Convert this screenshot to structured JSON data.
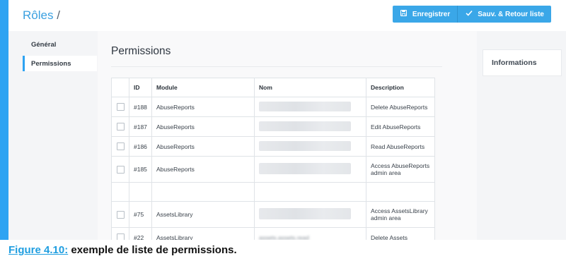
{
  "header": {
    "breadcrumb_title": "Rôles",
    "breadcrumb_separator": "/",
    "save_label": "Enregistrer",
    "save_return_label": "Sauv. & Retour liste",
    "save_icon": "floppy-disk-icon",
    "check_icon": "checkmark-icon"
  },
  "sidebar": {
    "items": [
      {
        "label": "Général"
      },
      {
        "label": "Permissions"
      }
    ]
  },
  "main": {
    "title": "Permissions",
    "table": {
      "columns": [
        "ID",
        "Module",
        "Nom",
        "Description"
      ],
      "rows": [
        {
          "id": "#188",
          "module": "AbuseReports",
          "description": "Delete AbuseReports"
        },
        {
          "id": "#187",
          "module": "AbuseReports",
          "description": "Edit AbuseReports"
        },
        {
          "id": "#186",
          "module": "AbuseReports",
          "description": "Read AbuseReports"
        },
        {
          "id": "#185",
          "module": "AbuseReports",
          "description": "Access AbuseReports admin area"
        },
        {
          "id": "#75",
          "module": "AssetsLibrary",
          "description": "Access AssetsLibrary admin area"
        },
        {
          "id": "#22",
          "module": "AssetsLibrary",
          "name": "assets.assets.read",
          "description": "Delete Assets"
        }
      ]
    }
  },
  "right_panel": {
    "title": "Informations"
  },
  "caption": {
    "figure_label": "Figure 4.10:",
    "text": " exemple de liste de permissions."
  },
  "colors": {
    "accent": "#2ea3f2",
    "button": "#3aa7e8",
    "caption_label": "#1f9ee0"
  }
}
